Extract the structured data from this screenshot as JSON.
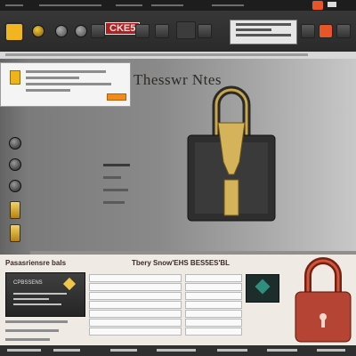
{
  "toolbar": {
    "brand_label": "CKE5"
  },
  "main": {
    "heading": "Thesswr Ntes"
  },
  "lower": {
    "title": "Pasasriensre bals",
    "subtitle": "Tbery Snow'EHS BES5ES'BL",
    "card_title": "CPBSSENS"
  },
  "colors": {
    "toolbar": "#2a2a2a",
    "accent_orange": "#f38b1c",
    "padlock_gold": "#d4b35a",
    "padlock_red": "#b64434",
    "panel": "#f4f4f4"
  },
  "icons": {
    "tool_lock": "padlock-icon",
    "main_lock": "padlock-icon",
    "bottom_lock": "padlock-icon",
    "card_diamond": "diamond-icon"
  }
}
